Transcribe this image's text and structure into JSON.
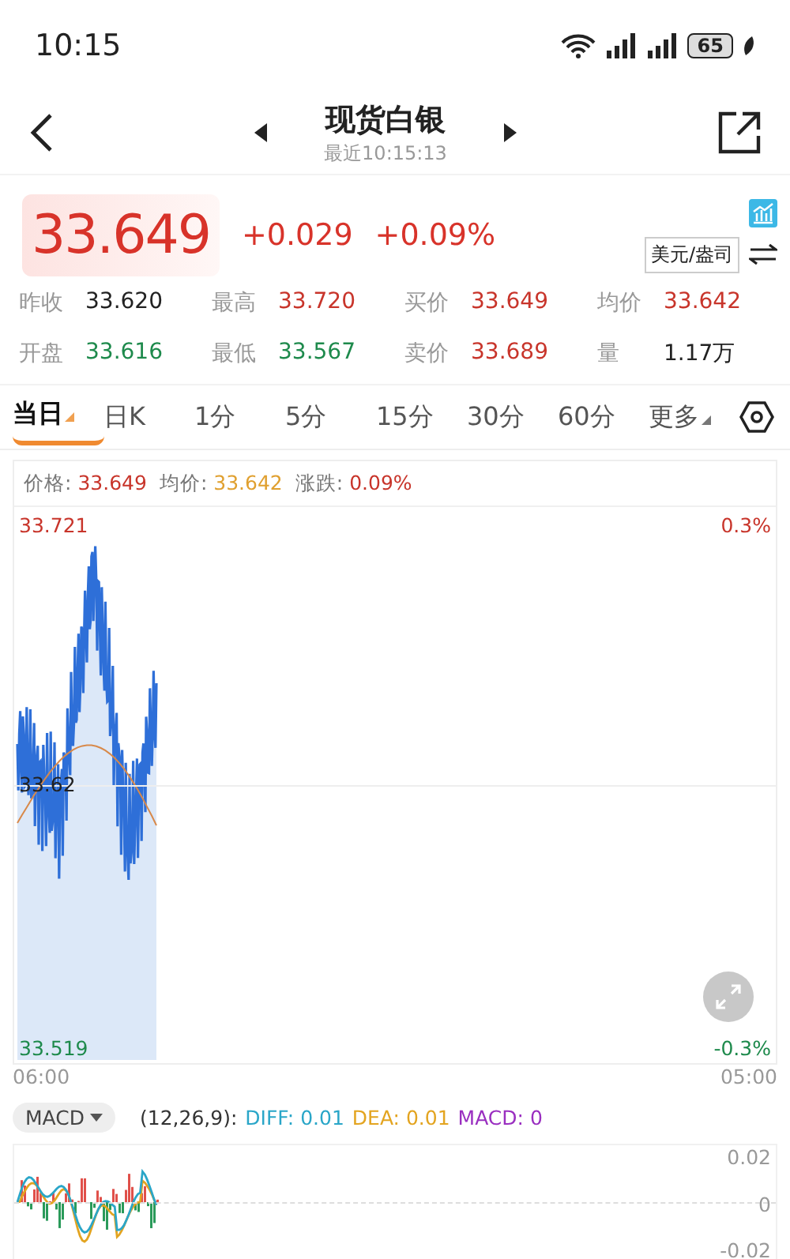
{
  "status_bar": {
    "time": "10:15",
    "battery": "65"
  },
  "header": {
    "title": "现货白银",
    "subtitle": "最近10:15:13"
  },
  "quote": {
    "price": "33.649",
    "change": "+0.029",
    "change_pct": "+0.09%",
    "unit": "美元/盎司"
  },
  "stats": [
    {
      "label": "昨收",
      "value": "33.620",
      "color": "#222222"
    },
    {
      "label": "最高",
      "value": "33.720",
      "color": "#c8352b"
    },
    {
      "label": "买价",
      "value": "33.649",
      "color": "#c8352b"
    },
    {
      "label": "均价",
      "value": "33.642",
      "color": "#c8352b"
    },
    {
      "label": "开盘",
      "value": "33.616",
      "color": "#1e8a4c"
    },
    {
      "label": "最低",
      "value": "33.567",
      "color": "#1e8a4c"
    },
    {
      "label": "卖价",
      "value": "33.689",
      "color": "#c8352b"
    },
    {
      "label": "量",
      "value": "1.17万",
      "color": "#222222"
    }
  ],
  "tabs": [
    {
      "label": "当日",
      "selected": true,
      "dropdown": true
    },
    {
      "label": "日K",
      "selected": false,
      "dropdown": false
    },
    {
      "label": "1分",
      "selected": false,
      "dropdown": false
    },
    {
      "label": "5分",
      "selected": false,
      "dropdown": false
    },
    {
      "label": "15分",
      "selected": false,
      "dropdown": false
    },
    {
      "label": "30分",
      "selected": false,
      "dropdown": false
    },
    {
      "label": "60分",
      "selected": false,
      "dropdown": false
    },
    {
      "label": "更多",
      "selected": false,
      "dropdown": true
    }
  ],
  "chart": {
    "legend": [
      {
        "label": "价格:",
        "value": "33.649",
        "color": "#c8352b"
      },
      {
        "label": "均价:",
        "value": "33.642",
        "color": "#e0a030"
      },
      {
        "label": "涨跌:",
        "value": "0.09%",
        "color": "#c8352b"
      }
    ],
    "y_max": "33.721",
    "y_mid": "33.62",
    "y_min": "33.519",
    "pct_max": "0.3%",
    "pct_min": "-0.3%",
    "time_start": "06:00",
    "time_end": "05:00"
  },
  "macd": {
    "selector": "MACD",
    "params": "(12,26,9):",
    "values": [
      {
        "text": "DIFF: 0.01",
        "color": "#2aa6c8"
      },
      {
        "text": "DEA: 0.01",
        "color": "#e3a420"
      },
      {
        "text": "MACD: 0",
        "color": "#9a2fc0"
      }
    ],
    "y_ticks": [
      "0.02",
      "0",
      "-0.02"
    ]
  }
}
